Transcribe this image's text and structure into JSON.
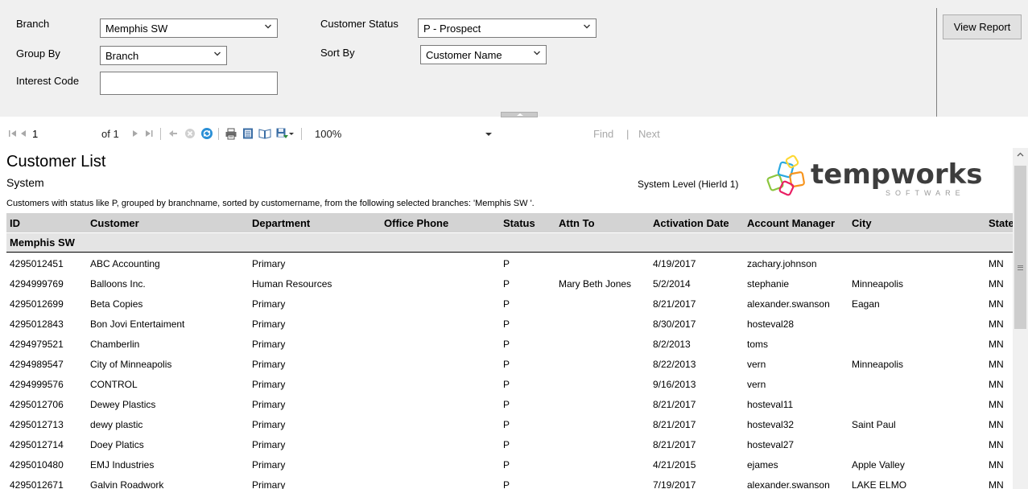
{
  "params": {
    "branch_label": "Branch",
    "branch_value": "Memphis SW",
    "group_by_label": "Group By",
    "group_by_value": "Branch",
    "interest_code_label": "Interest Code",
    "interest_code_value": "",
    "customer_status_label": "Customer Status",
    "customer_status_value": "P - Prospect",
    "sort_by_label": "Sort By",
    "sort_by_value": "Customer Name",
    "view_report_label": "View Report"
  },
  "toolbar": {
    "page_current": "1",
    "page_of": "of 1",
    "zoom": "100%",
    "find_label": "Find",
    "separator": "|",
    "next_label": "Next",
    "find_value": ""
  },
  "report": {
    "title": "Customer List",
    "subtitle": "System",
    "level": "System Level (HierId 1)",
    "description": "Customers with status like P, grouped by branchname, sorted by customername, from the following selected branches: 'Memphis SW '.",
    "logo_word": "tempworks",
    "logo_sub": "SOFTWARE",
    "columns": [
      "ID",
      "Customer",
      "Department",
      "Office Phone",
      "Status",
      "Attn To",
      "Activation Date",
      "Account Manager",
      "City",
      "State"
    ],
    "group_name": "Memphis SW",
    "rows": [
      {
        "id": "4295012451",
        "customer": "ABC Accounting",
        "department": "Primary",
        "phone": "",
        "status": "P",
        "attn": "",
        "activation": "4/19/2017",
        "manager": "zachary.johnson",
        "city": "",
        "state": "MN"
      },
      {
        "id": "4294999769",
        "customer": "Balloons Inc.",
        "department": "Human Resources",
        "phone": "",
        "status": "P",
        "attn": "Mary Beth Jones",
        "activation": "5/2/2014",
        "manager": "stephanie",
        "city": "Minneapolis",
        "state": "MN"
      },
      {
        "id": "4295012699",
        "customer": "Beta Copies",
        "department": "Primary",
        "phone": "",
        "status": "P",
        "attn": "",
        "activation": "8/21/2017",
        "manager": "alexander.swanson",
        "city": "Eagan",
        "state": "MN"
      },
      {
        "id": "4295012843",
        "customer": "Bon Jovi Entertaiment",
        "department": "Primary",
        "phone": "",
        "status": "P",
        "attn": "",
        "activation": "8/30/2017",
        "manager": "hosteval28",
        "city": "",
        "state": "MN"
      },
      {
        "id": "4294979521",
        "customer": "Chamberlin",
        "department": "Primary",
        "phone": "",
        "status": "P",
        "attn": "",
        "activation": "8/2/2013",
        "manager": "toms",
        "city": "",
        "state": "MN"
      },
      {
        "id": "4294989547",
        "customer": "City of Minneapolis",
        "department": "Primary",
        "phone": "",
        "status": "P",
        "attn": "",
        "activation": "8/22/2013",
        "manager": "vern",
        "city": "Minneapolis",
        "state": "MN"
      },
      {
        "id": "4294999576",
        "customer": "CONTROL",
        "department": "Primary",
        "phone": "",
        "status": "P",
        "attn": "",
        "activation": "9/16/2013",
        "manager": "vern",
        "city": "",
        "state": "MN"
      },
      {
        "id": "4295012706",
        "customer": "Dewey Plastics",
        "department": "Primary",
        "phone": "",
        "status": "P",
        "attn": "",
        "activation": "8/21/2017",
        "manager": "hosteval11",
        "city": "",
        "state": "MN"
      },
      {
        "id": "4295012713",
        "customer": "dewy plastic",
        "department": "Primary",
        "phone": "",
        "status": "P",
        "attn": "",
        "activation": "8/21/2017",
        "manager": "hosteval32",
        "city": "Saint Paul",
        "state": "MN"
      },
      {
        "id": "4295012714",
        "customer": "Doey Platics",
        "department": "Primary",
        "phone": "",
        "status": "P",
        "attn": "",
        "activation": "8/21/2017",
        "manager": "hosteval27",
        "city": "",
        "state": "MN"
      },
      {
        "id": "4295010480",
        "customer": "EMJ Industries",
        "department": "Primary",
        "phone": "",
        "status": "P",
        "attn": "",
        "activation": "4/21/2015",
        "manager": "ejames",
        "city": "Apple Valley",
        "state": "MN"
      },
      {
        "id": "4295012671",
        "customer": "Galvin Roadwork",
        "department": "Primary",
        "phone": "",
        "status": "P",
        "attn": "",
        "activation": "7/19/2017",
        "manager": "alexander.swanson",
        "city": "LAKE ELMO",
        "state": "MN"
      }
    ]
  }
}
